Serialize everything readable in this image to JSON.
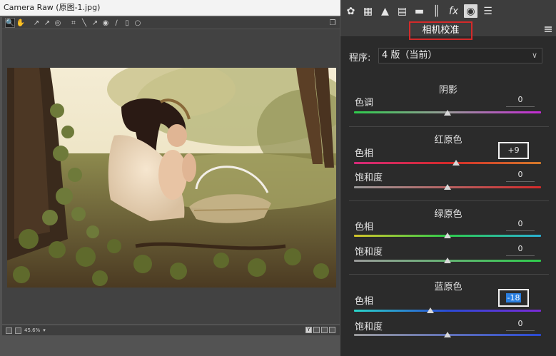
{
  "window": {
    "title": "Camera Raw (原图-1.jpg)"
  },
  "toolbar": {
    "tools": [
      "zoom-tool-icon",
      "hand-tool-icon",
      "white-balance-tool-icon",
      "color-sampler-tool-icon",
      "targeted-adjustment-tool-icon",
      "crop-tool-icon",
      "straighten-tool-icon",
      "spot-removal-tool-icon",
      "red-eye-tool-icon",
      "brush-tool-icon",
      "graduated-filter-icon",
      "radial-filter-icon"
    ],
    "open_preferences": "fullscreen-toggle-icon"
  },
  "statusbar": {
    "zoom": "45.6%"
  },
  "panel": {
    "tabs": [
      "basic-tab-icon",
      "tone-curve-tab-icon",
      "detail-tab-icon",
      "hsl-tab-icon",
      "split-toning-tab-icon",
      "lens-corrections-tab-icon",
      "effects-tab-icon",
      "camera-calibration-tab-icon",
      "presets-tab-icon"
    ],
    "active_tab": "camera-calibration-tab-icon",
    "title": "相机校准",
    "process_label": "程序:",
    "process_value": "4 版（当前）"
  },
  "sections": {
    "shadows": {
      "title": "阴影",
      "rows": [
        {
          "label": "色调",
          "value": "0",
          "position": 0.5
        }
      ]
    },
    "red": {
      "title": "红原色",
      "rows": [
        {
          "label": "色相",
          "value": "+9",
          "position": 0.545
        },
        {
          "label": "饱和度",
          "value": "0",
          "position": 0.5
        }
      ]
    },
    "green": {
      "title": "绿原色",
      "rows": [
        {
          "label": "色相",
          "value": "0",
          "position": 0.5
        },
        {
          "label": "饱和度",
          "value": "0",
          "position": 0.5
        }
      ]
    },
    "blue": {
      "title": "蓝原色",
      "rows": [
        {
          "label": "色相",
          "value": "-18",
          "position": 0.41
        },
        {
          "label": "饱和度",
          "value": "0",
          "position": 0.5
        }
      ]
    }
  },
  "colors": {
    "highlight_frame": "#d42a2a",
    "selection": "#2a7fe0"
  }
}
